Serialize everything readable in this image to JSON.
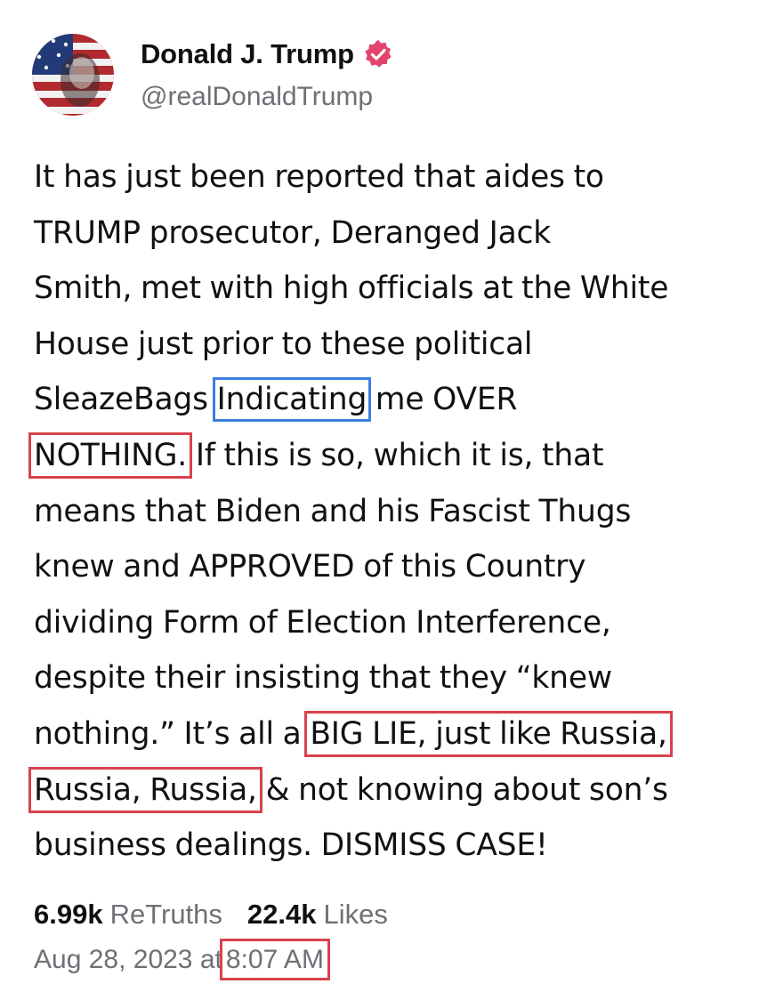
{
  "author": {
    "display_name": "Donald J. Trump",
    "handle": "@realDonaldTrump",
    "verified_icon": "verified-badge-icon",
    "verified_color": "#e2446e"
  },
  "post": {
    "lines": [
      [
        "It has just been reported that aides to"
      ],
      [
        "TRUMP prosecutor, Deranged Jack"
      ],
      [
        "Smith, met with high officials at the White"
      ],
      [
        "House just prior to these political"
      ],
      [
        "SleazeBags ",
        "Indicating",
        " me OVER"
      ],
      [
        "NOTHING.",
        " If this is so, which it is, that"
      ],
      [
        "means that Biden and his Fascist Thugs"
      ],
      [
        "knew and APPROVED of this Country"
      ],
      [
        "dividing Form of Election Interference,"
      ],
      [
        "despite their insisting that they “knew"
      ],
      [
        "nothing.” It’s all a ",
        "BIG LIE, just like Russia,"
      ],
      [
        "Russia, Russia,",
        " & not knowing about son’s"
      ],
      [
        "business dealings. DISMISS CASE!"
      ]
    ]
  },
  "stats": {
    "retruths_count": "6.99k",
    "retruths_label": "ReTruths",
    "likes_count": "22.4k",
    "likes_label": "Likes"
  },
  "timestamp": {
    "date": "Aug 28, 2023 at",
    "time": "8:07 AM"
  },
  "colors": {
    "annotation_blue": "#3c7fe0",
    "annotation_red": "#d9424c",
    "muted_text": "#6f6f76"
  }
}
